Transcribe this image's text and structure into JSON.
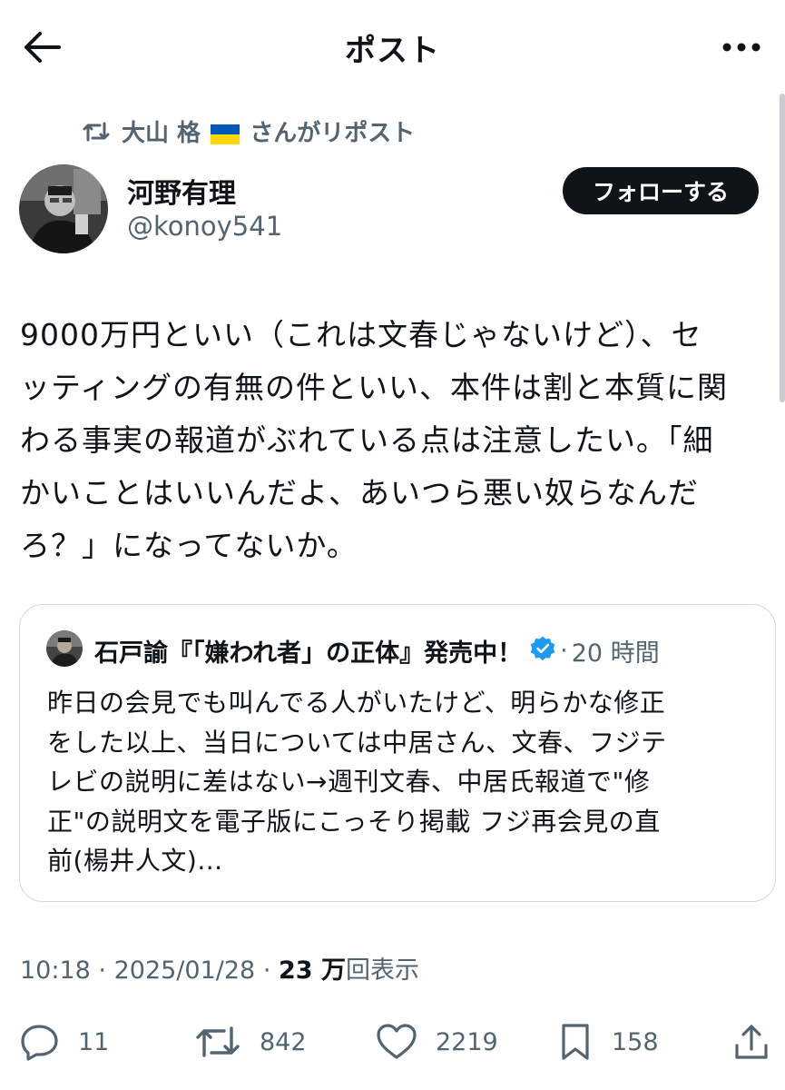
{
  "header": {
    "title": "ポスト",
    "back_icon": "arrow-left-icon",
    "more_icon": "more-horizontal-icon"
  },
  "repost": {
    "text_before_flag": "大山 格",
    "text_after_flag": "さんがリポスト",
    "flag": "ukraine-flag-icon"
  },
  "author": {
    "name": "河野有理",
    "handle": "@konoy541"
  },
  "follow_label": "フォローする",
  "post": {
    "text": "9000万円といい（これは文春じゃないけど）、セ\nッティングの有無の件といい、本件は割と本質に関\nわる事実の報道がぶれている点は注意したい。「細\nかいことはいいんだよ、あいつら悪い奴らなんだ\nろ？」になってないか。"
  },
  "quote": {
    "author_name": "石戸諭『「嫌われ者」の正体』発売中！",
    "separator": "·",
    "time": "20 時間",
    "text": "昨日の会見でも叫んでる人がいたけど、明らかな修正\nをした以上、当日については中居さん、文春、フジテ\nレビの説明に差はない→週刊文春、中居氏報道で\"修\n正\"の説明文を電子版にこっそり掲載 フジ再会見の直\n前(楊井人文)..."
  },
  "meta": {
    "time": "10:18",
    "separator1": "·",
    "date": "2025/01/28",
    "separator2": "·",
    "views_count": "23 万",
    "views_label": "回表示"
  },
  "actions": {
    "reply_count": "11",
    "repost_count": "842",
    "like_count": "2219",
    "bookmark_count": "158"
  },
  "colors": {
    "text": "#0f1419",
    "secondary": "#536471",
    "verified": "#1d9bf0",
    "border": "#cfd9de"
  }
}
